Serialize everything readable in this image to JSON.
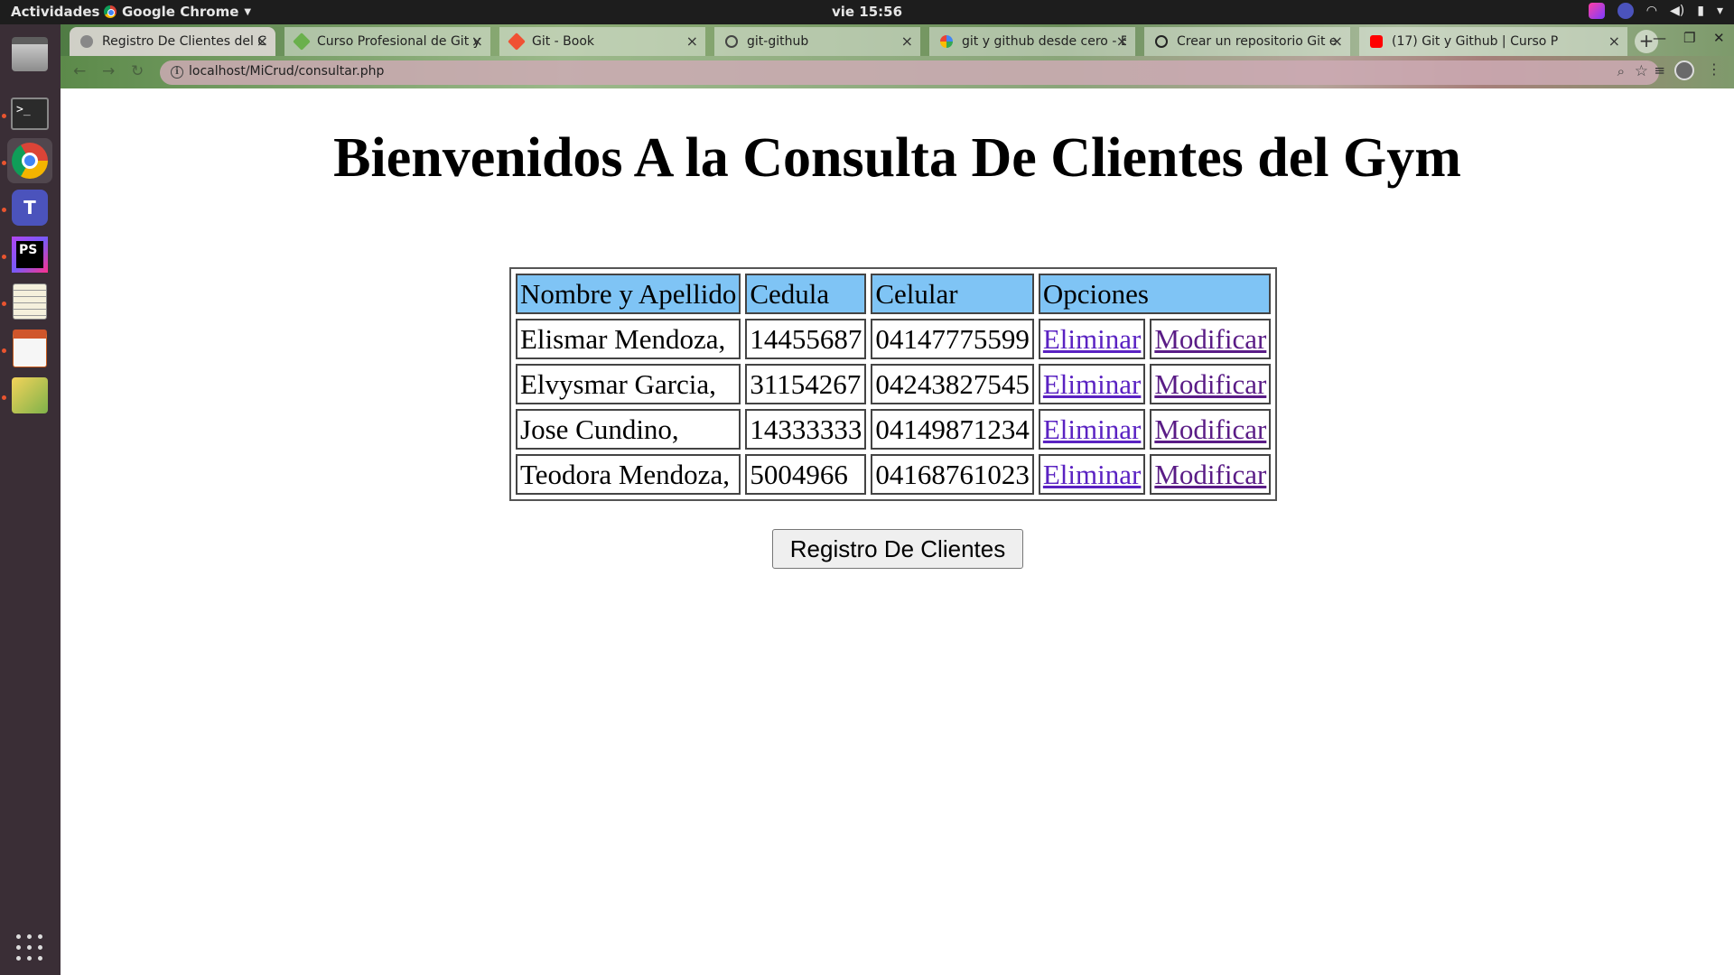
{
  "topbar": {
    "activities": "Actividades",
    "app_name": "Google Chrome",
    "clock": "vie 15:56"
  },
  "browser": {
    "tabs": [
      {
        "title": "Registro De Clientes del C",
        "active": true
      },
      {
        "title": "Curso Profesional de Git y",
        "active": false
      },
      {
        "title": "Git - Book",
        "active": false
      },
      {
        "title": "git-github",
        "active": false
      },
      {
        "title": "git y github desde cero - B",
        "active": false
      },
      {
        "title": "Crear un repositorio Git e",
        "active": false
      },
      {
        "title": "(17) Git y Github | Curso P",
        "active": false
      }
    ],
    "url": "localhost/MiCrud/consultar.php"
  },
  "page": {
    "title": "Bienvenidos A la Consulta De Clientes del Gym",
    "table": {
      "headers": [
        "Nombre y Apellido",
        "Cedula",
        "Celular",
        "Opciones"
      ],
      "rows": [
        {
          "nombre": "Elismar Mendoza,",
          "cedula": "14455687",
          "celular": "04147775599",
          "eliminar": "Eliminar",
          "modificar": "Modificar"
        },
        {
          "nombre": "Elvysmar Garcia,",
          "cedula": "31154267",
          "celular": "04243827545",
          "eliminar": "Eliminar",
          "modificar": "Modificar"
        },
        {
          "nombre": "Jose Cundino,",
          "cedula": "14333333",
          "celular": "04149871234",
          "eliminar": "Eliminar",
          "modificar": "Modificar"
        },
        {
          "nombre": "Teodora Mendoza,",
          "cedula": "5004966",
          "celular": "04168761023",
          "eliminar": "Eliminar",
          "modificar": "Modificar"
        }
      ]
    },
    "button_label": "Registro De Clientes"
  },
  "colors": {
    "header_bg": "#7fc4f5",
    "link": "#5a22c2",
    "link_visited": "#5a1c86",
    "dock_bg": "#3a2e36",
    "topbar_bg": "#1d1d1d"
  },
  "icons": [
    "chrome-icon",
    "caret-down-icon",
    "wifi-icon",
    "volume-icon",
    "battery-icon",
    "files-icon",
    "terminal-icon",
    "teams-icon",
    "phpstorm-icon",
    "text-editor-icon",
    "impress-icon",
    "image-viewer-icon",
    "app-grid-icon",
    "info-icon",
    "zoom-icon",
    "star-icon",
    "close-icon",
    "plus-icon",
    "minimize-icon",
    "maximize-icon"
  ]
}
